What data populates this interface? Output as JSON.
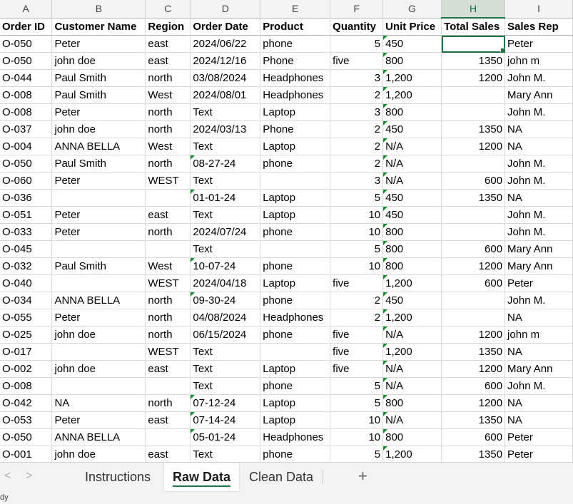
{
  "columns": [
    "A",
    "B",
    "C",
    "D",
    "E",
    "F",
    "G",
    "H",
    "I"
  ],
  "headers": [
    "Order ID",
    "Customer Name",
    "Region",
    "Order Date",
    "Product",
    "Quantity",
    "Unit Price",
    "Total Sales",
    "Sales Rep"
  ],
  "rows": [
    [
      "O-050",
      "  Peter",
      "east",
      "2024/06/22",
      "phone",
      "5",
      "450",
      "",
      "Peter"
    ],
    [
      "O-050",
      "john doe",
      "east",
      "2024/12/16",
      "Phone",
      "five",
      "800",
      "1350",
      "john m"
    ],
    [
      "O-044",
      "Paul  Smith",
      "north",
      "03/08/2024",
      "Headphones",
      "3",
      "1,200",
      "1200",
      "John M."
    ],
    [
      "O-008",
      "Paul  Smith",
      "West",
      "2024/08/01",
      "Headphones",
      "2",
      "1,200",
      "",
      "Mary  Ann"
    ],
    [
      "O-008",
      "  Peter",
      "north",
      "Text",
      "Laptop",
      "3",
      "800",
      "",
      "John M."
    ],
    [
      "O-037",
      "john doe",
      "north",
      "2024/03/13",
      "Phone",
      "2",
      "450",
      "1350",
      "NA"
    ],
    [
      "O-004",
      "ANNA  BELLA",
      "West",
      "Text",
      "Laptop",
      "2",
      "N/A",
      "1200",
      "NA"
    ],
    [
      "O-050",
      "Paul  Smith",
      "north",
      "08-27-24",
      "phone",
      "2",
      "N/A",
      "",
      "John M."
    ],
    [
      "O-060",
      "  Peter",
      "WEST",
      "Text",
      "",
      "3",
      "N/A",
      "600",
      "John M."
    ],
    [
      "O-036",
      "",
      "",
      "01-01-24",
      "Laptop",
      "5",
      "450",
      "1350",
      "NA"
    ],
    [
      "O-051",
      "  Peter",
      "east",
      "Text",
      "Laptop",
      "10",
      "450",
      "",
      "John M."
    ],
    [
      "O-033",
      "  Peter",
      "north",
      "2024/07/24",
      "phone",
      "10",
      "800",
      "",
      "John M."
    ],
    [
      "O-045",
      "",
      "",
      "Text",
      "",
      "5",
      "800",
      "600",
      "Mary  Ann"
    ],
    [
      "O-032",
      "Paul  Smith",
      "West",
      "10-07-24",
      "phone",
      "10",
      "800",
      "1200",
      "Mary  Ann"
    ],
    [
      "O-040",
      "",
      "WEST",
      "2024/04/18",
      "Laptop",
      "five",
      "1,200",
      "600",
      "Peter"
    ],
    [
      "O-034",
      "ANNA  BELLA",
      "north",
      "09-30-24",
      "phone",
      "2",
      "450",
      "",
      "John M."
    ],
    [
      "O-055",
      "  Peter",
      "north",
      "04/08/2024",
      "Headphones",
      "2",
      "1,200",
      "",
      "NA"
    ],
    [
      "O-025",
      "john doe",
      "north",
      "06/15/2024",
      "phone",
      "five",
      "N/A",
      "1200",
      "john m"
    ],
    [
      "O-017",
      "",
      "WEST",
      "Text",
      "",
      "five",
      "1,200",
      "1350",
      "NA"
    ],
    [
      "O-002",
      "john doe",
      "east",
      "Text",
      "Laptop",
      "five",
      "N/A",
      "1200",
      "Mary  Ann"
    ],
    [
      "O-008",
      "",
      "",
      "Text",
      "phone",
      "5",
      "N/A",
      "600",
      "John M."
    ],
    [
      "O-042",
      "NA",
      "north",
      "07-12-24",
      "Laptop",
      "5",
      "800",
      "1200",
      "NA"
    ],
    [
      "O-053",
      "  Peter",
      "east",
      "07-14-24",
      "Laptop",
      "10",
      "N/A",
      "1350",
      "NA"
    ],
    [
      "O-050",
      "ANNA  BELLA",
      "",
      "05-01-24",
      "Headphones",
      "10",
      "800",
      "600",
      "Peter"
    ],
    [
      "O-001",
      "john doe",
      "east",
      "Text",
      "phone",
      "5",
      "1,200",
      "1350",
      "Peter"
    ]
  ],
  "selected_cell": "H2",
  "active_column": "H",
  "tabs": [
    {
      "label": "Instructions",
      "active": false
    },
    {
      "label": "Raw Data",
      "active": true
    },
    {
      "label": "Clean Data",
      "active": false
    }
  ],
  "add_sheet_symbol": "+",
  "nav": {
    "prev": "<",
    "next": ">"
  },
  "status_text": "dy",
  "colors": {
    "accent": "#217346",
    "flag": "#1e8a3c",
    "grid": "#d9d9d9",
    "header_bg": "#f3f3f3"
  }
}
